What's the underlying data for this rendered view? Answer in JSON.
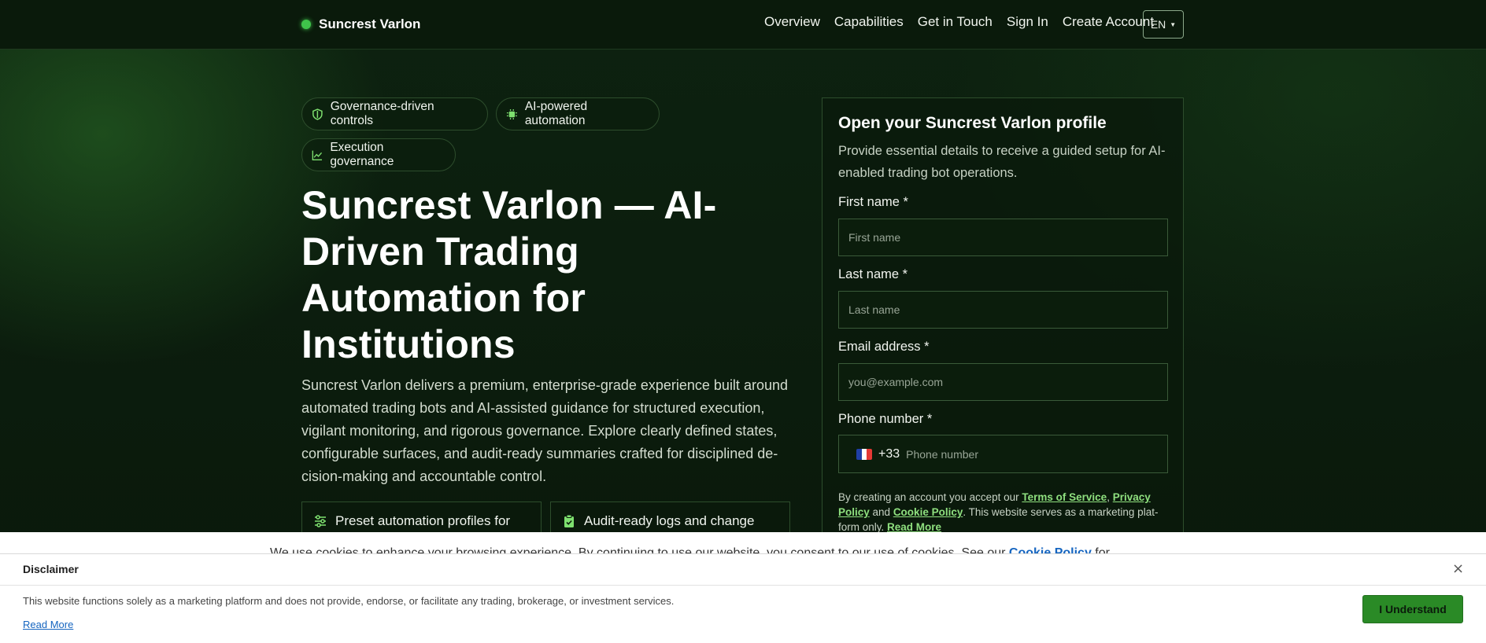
{
  "brand": {
    "name": "Suncrest Varlon",
    "accent": "#3fc24a"
  },
  "nav": {
    "links": [
      "Overview",
      "Capabilities",
      "Get in Touch",
      "Sign In",
      "Create Account"
    ],
    "language": "EN"
  },
  "badges": [
    {
      "label": "Governance-driven controls",
      "icon": "shield-icon"
    },
    {
      "label": "AI-powered automation",
      "icon": "chip-icon"
    },
    {
      "label": "Execution governance",
      "icon": "chart-line-icon"
    }
  ],
  "hero": {
    "title": "Suncrest Varlon — AI-Driven Trading Automation for Institutions",
    "description": "Suncrest Varlon delivers a premium, enterprise-grade experience built around automated trading bots and AI-assisted guidance for structured execution, vigilant monitoring, and rigorous governance. Explore clearly defined states, configurable surfaces, and audit-ready summaries crafted for disciplined de-cision-making and accountable control."
  },
  "features": [
    {
      "label": "Preset automation profiles for",
      "icon": "sliders-icon"
    },
    {
      "label": "Audit-ready logs and change",
      "icon": "clipboard-check-icon"
    }
  ],
  "form": {
    "title": "Open your Suncrest Varlon profile",
    "subtitle": "Provide essential details to receive a guided setup for AI-enabled trading bot operations.",
    "first_name_label": "First name *",
    "first_name_placeholder": "First name",
    "last_name_label": "Last name *",
    "last_name_placeholder": "Last name",
    "email_label": "Email address *",
    "email_placeholder": "you@example.com",
    "phone_label": "Phone number *",
    "phone_dial_code": "+33",
    "phone_placeholder": "Phone number",
    "terms_prefix": "By creating an account you accept our ",
    "terms_link": "Terms of Service",
    "terms_sep": ", ",
    "privacy_link": "Privacy Policy",
    "terms_and": " and ",
    "cookie_link": "Cookie Policy",
    "terms_suffix": ". This website serves as a marketing plat-form only. ",
    "read_more_link": "Read More"
  },
  "cookie_notice": {
    "text": "We use cookies to enhance your browsing experience. By continuing to use our website, you consent to our use of cookies. See our ",
    "link": "Cookie Policy",
    "text_after": " for"
  },
  "disclaimer": {
    "title": "Disclaimer",
    "close_icon": "close-icon",
    "body": "This website functions solely as a marketing platform and does not provide, endorse, or facilitate any trading, brokerage, or investment services.",
    "read_more": "Read More",
    "button": "I Understand",
    "button_color": "#2a8a26"
  }
}
